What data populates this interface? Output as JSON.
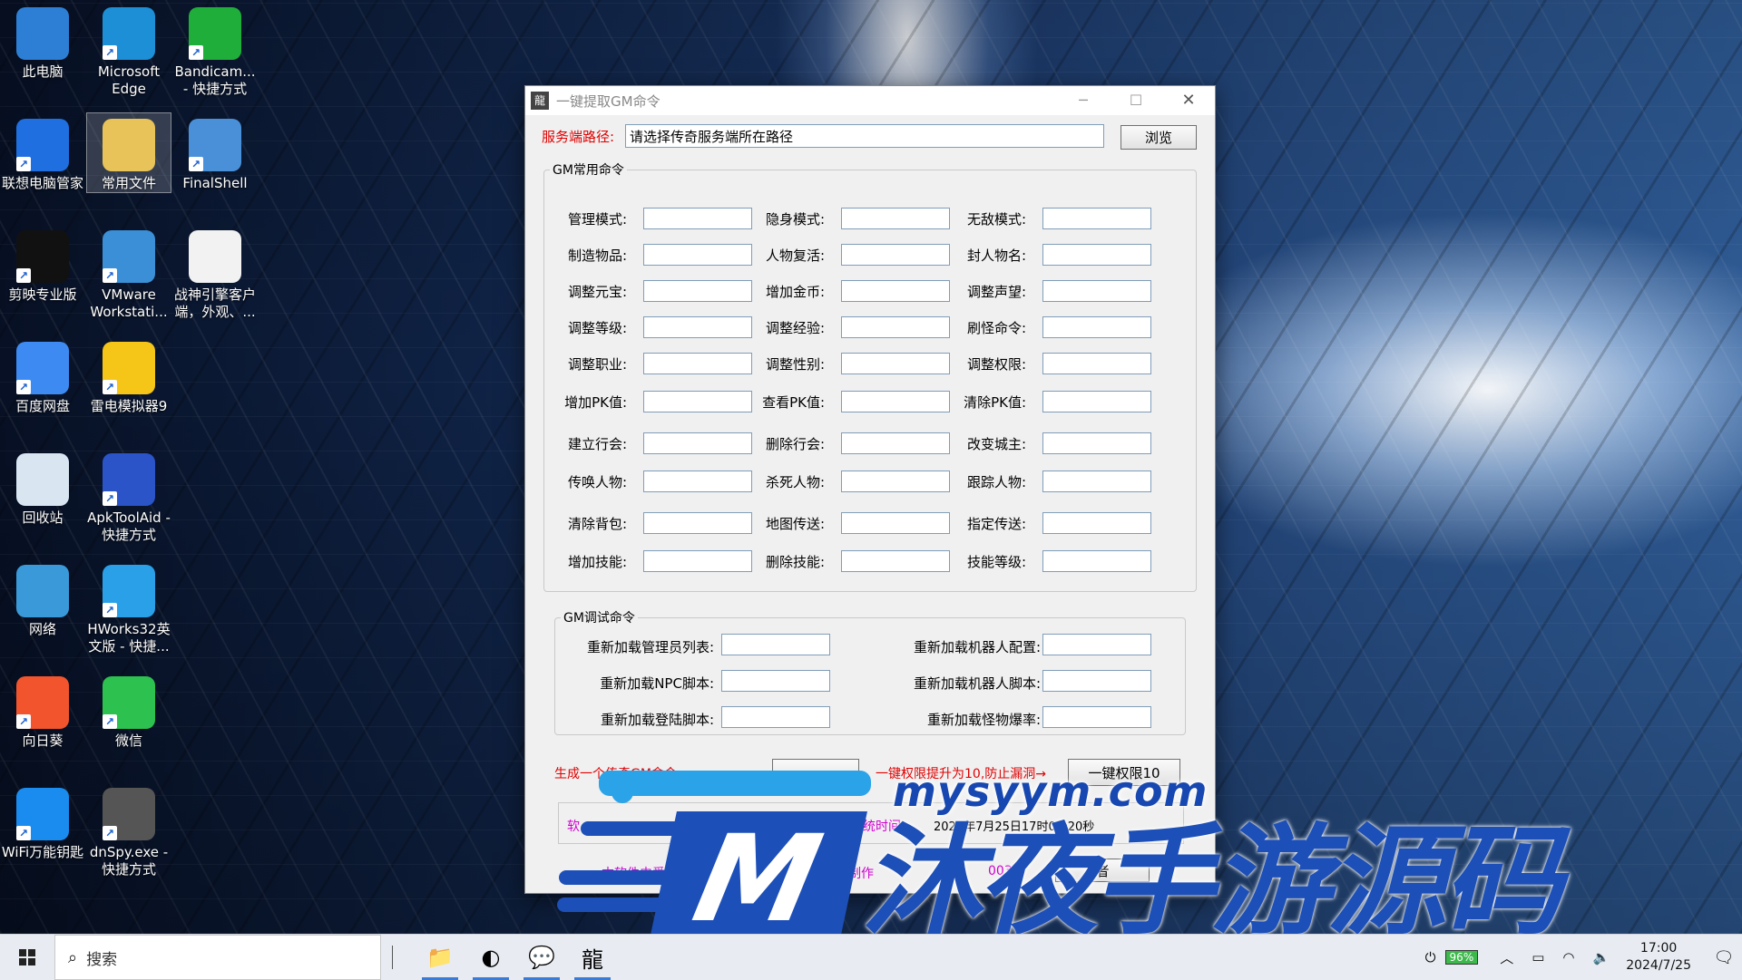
{
  "desktop": {
    "icons": [
      {
        "label": "此电脑",
        "icon": "computer-icon",
        "color": "#2d7fd6"
      },
      {
        "label": "Microsoft Edge",
        "icon": "edge-icon",
        "color": "#1c8fd6"
      },
      {
        "label": "Bandicam... - 快捷方式",
        "icon": "bandicam-icon",
        "color": "#1fae3a"
      },
      {
        "label": "联想电脑管家",
        "icon": "lenovo-manager-icon",
        "color": "#1f6fe0"
      },
      {
        "label": "常用文件",
        "icon": "folder-icon",
        "color": "#e8c35a"
      },
      {
        "label": "FinalShell",
        "icon": "finalshell-icon",
        "color": "#4a90d9"
      },
      {
        "label": "剪映专业版",
        "icon": "capcut-icon",
        "color": "#111111"
      },
      {
        "label": "VMware Workstati...",
        "icon": "vmware-icon",
        "color": "#3a8fd6"
      },
      {
        "label": "战神引擎客户端，外观、...",
        "icon": "document-icon",
        "color": "#f2f2f2"
      },
      {
        "label": "百度网盘",
        "icon": "baidu-netdisk-icon",
        "color": "#3d8bf2"
      },
      {
        "label": "雷电模拟器9",
        "icon": "ldplayer-icon",
        "color": "#f5c518"
      },
      {
        "label": "回收站",
        "icon": "recycle-bin-icon",
        "color": "#d9e6f2"
      },
      {
        "label": "ApkToolAid - 快捷方式",
        "icon": "apktoolaid-icon",
        "color": "#2b54c8"
      },
      {
        "label": "网络",
        "icon": "network-icon",
        "color": "#3a9ad9"
      },
      {
        "label": "HWorks32英文版 - 快捷...",
        "icon": "hworks-icon",
        "color": "#2aa0e8"
      },
      {
        "label": "向日葵",
        "icon": "sunlogin-icon",
        "color": "#f2542d"
      },
      {
        "label": "微信",
        "icon": "wechat-icon",
        "color": "#2dc14f"
      },
      {
        "label": "WiFi万能钥匙",
        "icon": "wifi-key-icon",
        "color": "#1a8cf0"
      },
      {
        "label": "dnSpy.exe - 快捷方式",
        "icon": "dnspy-icon",
        "color": "#555555"
      }
    ]
  },
  "window": {
    "title": "一键提取GM命令",
    "minimize": "─",
    "maximize": "☐",
    "close": "✕",
    "path_label": "服务端路径:",
    "path_value": "请选择传奇服务端所在路径",
    "browse_label": "浏览",
    "group_common": "GM常用命令",
    "commands": [
      [
        "管理模式:",
        "隐身模式:",
        "无敌模式:"
      ],
      [
        "制造物品:",
        "人物复活:",
        "封人物名:"
      ],
      [
        "调整元宝:",
        "增加金币:",
        "调整声望:"
      ],
      [
        "调整等级:",
        "调整经验:",
        "刷怪命令:"
      ],
      [
        "调整职业:",
        "调整性别:",
        "调整权限:"
      ],
      [
        "增加PK值:",
        "查看PK值:",
        "清除PK值:"
      ],
      [
        "建立行会:",
        "删除行会:",
        "改变城主:"
      ],
      [
        "传唤人物:",
        "杀死人物:",
        "跟踪人物:"
      ],
      [
        "清除背包:",
        "地图传送:",
        "指定传送:"
      ],
      [
        "增加技能:",
        "删除技能:",
        "技能等级:"
      ]
    ],
    "group_debug": "GM调试命令",
    "debug_commands": [
      [
        "重新加载管理员列表:",
        "重新加载机器人配置:"
      ],
      [
        "重新加载NPC脚本:",
        "重新加载机器人脚本:"
      ],
      [
        "重新加载登陆脚本:",
        "重新加载怪物爆率:"
      ]
    ],
    "generate_text": "生成一个传奇GM命令",
    "generate_btn": "",
    "perm_text": "一键权限提升为10,防止漏洞→",
    "perm_btn": "一键权限10",
    "status_left": "软",
    "status_time_label": "系统时间:",
    "status_time_value": "2024年7月25日17时0分20秒",
    "footer_left": "本软件由爱上",
    "footer_mid": "制作",
    "footer_num": "003",
    "about_btn": "者"
  },
  "watermark": {
    "url": "mysyym.com",
    "big_m": "M",
    "big_text": "沐夜手游源码"
  },
  "taskbar": {
    "search_placeholder": "搜索",
    "apps": [
      {
        "icon": "file-explorer-icon",
        "glyph": "📁"
      },
      {
        "icon": "edge-icon",
        "glyph": "◐"
      },
      {
        "icon": "wechat-icon",
        "glyph": "💬"
      },
      {
        "icon": "gm-tool-icon",
        "glyph": "龍"
      }
    ],
    "battery": "96%",
    "time": "17:00",
    "date": "2024/7/25"
  }
}
